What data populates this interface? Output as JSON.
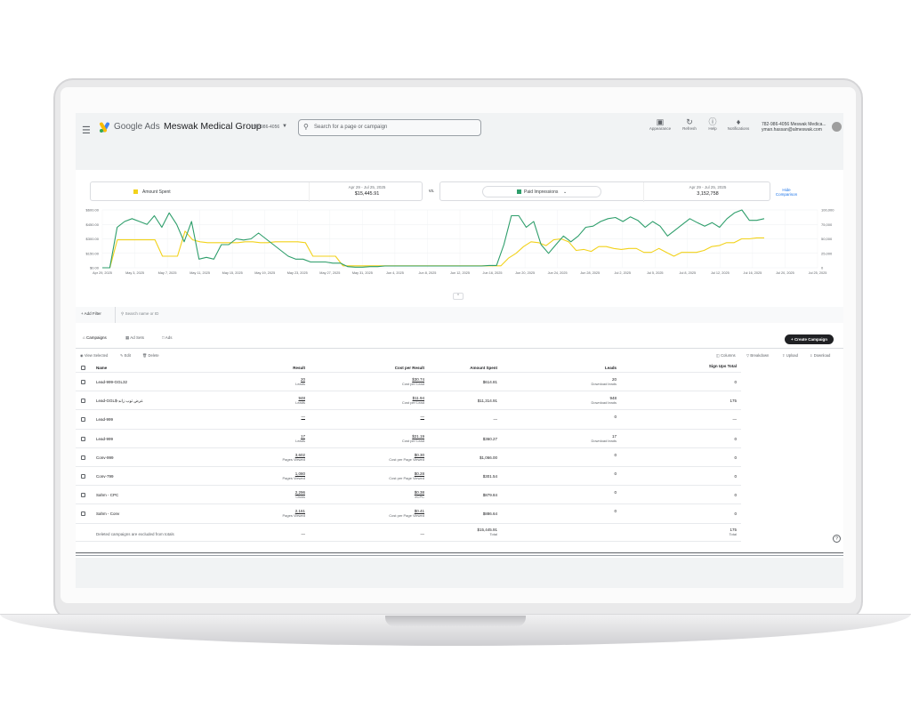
{
  "header": {
    "brand": "Google Ads",
    "account_name": "Meswak Medical Group",
    "account_id": "782-986-4056",
    "search_placeholder": "Search for a page or campaign",
    "tools": [
      {
        "label": "Appearance",
        "icon": "appearance-icon"
      },
      {
        "label": "Refresh",
        "icon": "refresh-icon"
      },
      {
        "label": "Help",
        "icon": "help-icon"
      },
      {
        "label": "Notifications",
        "icon": "bell-icon"
      }
    ],
    "user_line1": "782-986-4056 Meswak Medica...",
    "user_line2": "yman.hassan@almeswak.com"
  },
  "summary": {
    "metric1": {
      "label": "Amount Spent",
      "date_range": "Apr 29 - Jul 25, 2025",
      "total": "$15,445.91",
      "color": "#f2d21b"
    },
    "vs_label": "vs.",
    "metric2": {
      "label": "Paid Impressions",
      "date_range": "Apr 29 - Jul 25, 2025",
      "total": "3,152,758",
      "color": "#2e9e6b"
    },
    "hide_comparison": "Hide Comparison"
  },
  "chart_data": {
    "type": "line",
    "x_ticks": [
      "Apr 29, 2025",
      "May 3, 2025",
      "May 7, 2025",
      "May 11, 2025",
      "May 15, 2025",
      "May 19, 2025",
      "May 23, 2025",
      "May 27, 2025",
      "May 31, 2025",
      "Jun 4, 2025",
      "Jun 8, 2025",
      "Jun 12, 2025",
      "Jun 16, 2025",
      "Jun 20, 2025",
      "Jun 24, 2025",
      "Jun 28, 2025",
      "Jul 2, 2025",
      "Jul 5, 2025",
      "Jul 8, 2025",
      "Jul 12, 2025",
      "Jul 16, 2025",
      "Jul 20, 2025",
      "Jul 25, 2025"
    ],
    "y_left_ticks": [
      "$600.00",
      "$450.00",
      "$300.00",
      "$150.00",
      "$0.00"
    ],
    "y_left_range": [
      0,
      600
    ],
    "y_right_ticks": [
      "100,000",
      "75,000",
      "50,000",
      "25,000",
      "0"
    ],
    "y_right_range": [
      0,
      100000
    ],
    "series": [
      {
        "name": "Amount Spent",
        "axis": "left",
        "color": "#f2d21b",
        "values": [
          0,
          0,
          290,
          290,
          290,
          290,
          290,
          290,
          120,
          120,
          120,
          380,
          290,
          270,
          260,
          260,
          260,
          260,
          260,
          270,
          270,
          260,
          260,
          270,
          270,
          270,
          270,
          260,
          120,
          120,
          120,
          120,
          20,
          20,
          20,
          20,
          20,
          20,
          20,
          20,
          20,
          20,
          20,
          20,
          20,
          20,
          20,
          20,
          20,
          20,
          20,
          20,
          20,
          20,
          100,
          150,
          220,
          270,
          260,
          230,
          290,
          300,
          270,
          180,
          190,
          170,
          220,
          220,
          200,
          190,
          200,
          200,
          160,
          160,
          200,
          160,
          120,
          160,
          160,
          160,
          180,
          220,
          230,
          260,
          260,
          300,
          300,
          310,
          310
        ]
      },
      {
        "name": "Paid Impressions",
        "axis": "right",
        "color": "#2e9e6b",
        "values": [
          0,
          0,
          70000,
          80000,
          85000,
          80000,
          75000,
          90000,
          70000,
          95000,
          75000,
          45000,
          80000,
          15000,
          18000,
          15000,
          40000,
          40000,
          50000,
          48000,
          50000,
          60000,
          50000,
          40000,
          30000,
          20000,
          15000,
          15000,
          10000,
          10000,
          10000,
          8000,
          8000,
          2000,
          1000,
          1000,
          2000,
          2000,
          3000,
          3000,
          3000,
          3000,
          3000,
          3000,
          3000,
          3000,
          3000,
          3000,
          3000,
          3000,
          3000,
          3000,
          4000,
          4000,
          40000,
          90000,
          90000,
          70000,
          80000,
          40000,
          25000,
          40000,
          55000,
          45000,
          55000,
          70000,
          72000,
          80000,
          85000,
          87000,
          80000,
          88000,
          82000,
          70000,
          80000,
          72000,
          55000,
          65000,
          75000,
          85000,
          78000,
          72000,
          78000,
          70000,
          85000,
          95000,
          100000,
          82000,
          82000,
          85000
        ]
      }
    ]
  },
  "filter": {
    "add_filter": "Add Filter",
    "search_placeholder": "Search name or ID"
  },
  "tabs": [
    "Campaigns",
    "Ad Sets",
    "Ads"
  ],
  "create_button": "Create Campaign",
  "actions": {
    "view_selected": "View Selected",
    "edit": "Edit",
    "delete": "Delete",
    "columns": "Columns",
    "breakdown": "Breakdown",
    "upload": "Upload",
    "download": "Download"
  },
  "table": {
    "headers": [
      "Name",
      "Result",
      "Cost per Result",
      "Amount Spent",
      "Leads",
      "Sign Ups Total"
    ],
    "rows": [
      {
        "name": "Lead-999-GGL32",
        "result": "20",
        "result_sub": "Leads",
        "cpr": "$30.74",
        "cpr_sub": "Cost per Lead",
        "spent": "$614.81",
        "leads": "20",
        "leads_sub": "Download leads",
        "signups": "0"
      },
      {
        "name": "Lead-GGL$-عرض توب زاند",
        "result": "948",
        "result_sub": "Leads",
        "cpr": "$11.94",
        "cpr_sub": "Cost per Lead",
        "spent": "$11,314.91",
        "leads": "948",
        "leads_sub": "Download leads",
        "signups": "175"
      },
      {
        "name": "Lead-999",
        "result": "—",
        "result_sub": "",
        "cpr": "—",
        "cpr_sub": "",
        "spent": "—",
        "leads": "0",
        "leads_sub": "",
        "signups": "—"
      },
      {
        "name": "Lead-999",
        "result": "17",
        "result_sub": "Leads",
        "cpr": "$21.19",
        "cpr_sub": "Cost per Lead",
        "spent": "$360.27",
        "leads": "17",
        "leads_sub": "Download leads",
        "signups": "0"
      },
      {
        "name": "Conv-999",
        "result": "3,602",
        "result_sub": "Pages Viewed",
        "cpr": "$0.30",
        "cpr_sub": "Cost per Page Viewed",
        "spent": "$1,066.00",
        "leads": "0",
        "leads_sub": "",
        "signups": "0"
      },
      {
        "name": "Conv-799",
        "result": "1,080",
        "result_sub": "Pages Viewed",
        "cpr": "$0.28",
        "cpr_sub": "Cost per Page Viewed",
        "spent": "$301.54",
        "leads": "0",
        "leads_sub": "",
        "signups": "0"
      },
      {
        "name": "Sahm - CPC",
        "result": "2,296",
        "result_sub": "Clicks",
        "cpr": "$0.38",
        "cpr_sub": "eCPC",
        "spent": "$879.84",
        "leads": "0",
        "leads_sub": "",
        "signups": "0"
      },
      {
        "name": "Sahm - Conv",
        "result": "2,161",
        "result_sub": "Pages Viewed",
        "cpr": "$0.41",
        "cpr_sub": "Cost per Page Viewed",
        "spent": "$886.64",
        "leads": "0",
        "leads_sub": "",
        "signups": "0"
      }
    ],
    "footer": {
      "note": "Deleted campaigns are excluded from totals",
      "result": "—",
      "cpr": "—",
      "spent": "$15,445.91",
      "spent_sub": "Total",
      "signups": "175",
      "signups_sub": "Total"
    }
  }
}
